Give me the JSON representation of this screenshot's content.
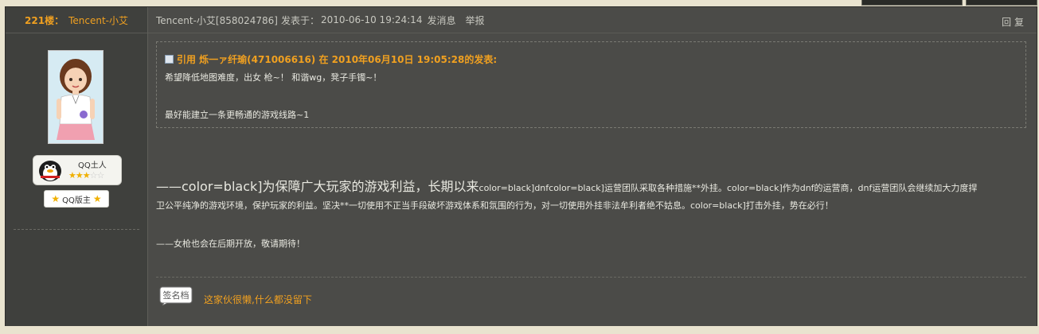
{
  "post": {
    "floor": "221楼：",
    "author_name": "Tencent-小艾",
    "author_header": "Tencent-小艾[858024786]",
    "posted_label": "发表于：",
    "posted_time": "2010-06-10 19:24:14",
    "send_message": "发消息",
    "report": "举报",
    "reply": "回 复"
  },
  "user": {
    "rank_name": "QQ土人",
    "rank_stars_filled": 3,
    "rank_stars_total": 5,
    "moderator_label": "QQ版主"
  },
  "quote": {
    "header": "引用 烁一ァ纤瑜(471006616) 在 2010年06月10日 19:05:28的发表:",
    "line1": "希望降低地图难度，出女 枪~！ 和谐wg，凳子手镯~！",
    "line2": "最好能建立一条更畅通的游戏线路~1"
  },
  "body": {
    "line1_big_a": "——color=black]",
    "line1_big_b": "为保障广大玩家的游戏利益，长期以来",
    "line1_small": "color=black]dnfcolor=black]运营团队采取各种措施**外挂。color=black]作为dnf的运营商，dnf运营团队会继续加大力度捍",
    "line2": "卫公平纯净的游戏环境，保护玩家的利益。坚决**一切使用不正当手段破坏游戏体系和氛围的行为，对一切使用外挂非法牟利者绝不姑息。color=black]打击外挂，势在必行！",
    "line3": "——女枪也会在后期开放，敬请期待！"
  },
  "signature": {
    "icon_label": "签名档",
    "text": "这家伙很懒,什么都没留下"
  },
  "colors": {
    "accent": "#f0a020",
    "panel": "#4b4b48",
    "sidebar": "#3f403d"
  }
}
